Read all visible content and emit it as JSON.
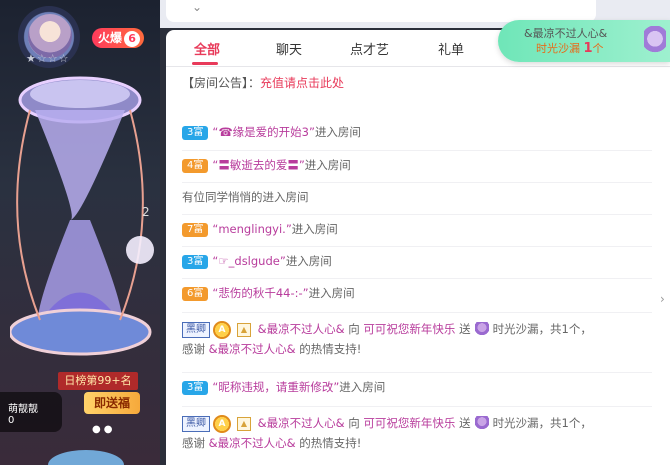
{
  "stage": {
    "stars": "★☆☆☆",
    "hot_label": "火爆",
    "hot_value": "6",
    "rank_label": "日榜第99+名",
    "send_gift_label": "即送福",
    "nick": "萌靓靓",
    "nick_count": "0",
    "number_mark": "2"
  },
  "top": {
    "chevron": "⌄"
  },
  "tabs": [
    "全部",
    "聊天",
    "点才艺",
    "礼单"
  ],
  "notice": {
    "prefix": "【房间公告】：",
    "link": "充值请点击此处"
  },
  "messages": [
    {
      "type": "enter",
      "level": "3富",
      "level_color": "blue",
      "name": "“☎缘是爱的开始3”",
      "suffix": "进入房间"
    },
    {
      "type": "enter",
      "level": "4富",
      "level_color": "orange",
      "name": "“〓敏逝去的爱〓”",
      "suffix": "进入房间"
    },
    {
      "type": "plain",
      "text": "有位同学悄悄的进入房间"
    },
    {
      "type": "enter",
      "level": "7富",
      "level_color": "orange",
      "name": "“menglingyi.”",
      "suffix": "进入房间"
    },
    {
      "type": "enter",
      "level": "3富",
      "level_color": "blue",
      "name": "“☞_dslgude”",
      "suffix": "进入房间"
    },
    {
      "type": "enter",
      "level": "6富",
      "level_color": "orange",
      "name": "“悲伤的秋千44-:-”",
      "suffix": "进入房间"
    },
    {
      "type": "gift",
      "tag": "黑卿",
      "sender": "&最凉不过人心&",
      "to": "向",
      "receiver": "可可祝您新年快乐",
      "send": "送",
      "gift": "时光沙漏",
      "count_text": "，共1个，",
      "thanks": "感谢",
      "thanks_name": "&最凉不过人心&",
      "thanks_suffix": "的热情支持!"
    },
    {
      "type": "enter",
      "level": "3富",
      "level_color": "blue",
      "name": "“昵称违规，请重新修改”",
      "suffix": "进入房间"
    },
    {
      "type": "gift",
      "tag": "黑卿",
      "sender": "&最凉不过人心&",
      "to": "向",
      "receiver": "可可祝您新年快乐",
      "send": "送",
      "gift": "时光沙漏",
      "count_text": "，共1个，",
      "thanks": "感谢",
      "thanks_name": "&最凉不过人心&",
      "thanks_suffix": "的热情支持!"
    }
  ],
  "popup": {
    "line1": "&最凉不过人心&",
    "gift": "时光沙漏",
    "count": "1",
    "unit": "个"
  }
}
